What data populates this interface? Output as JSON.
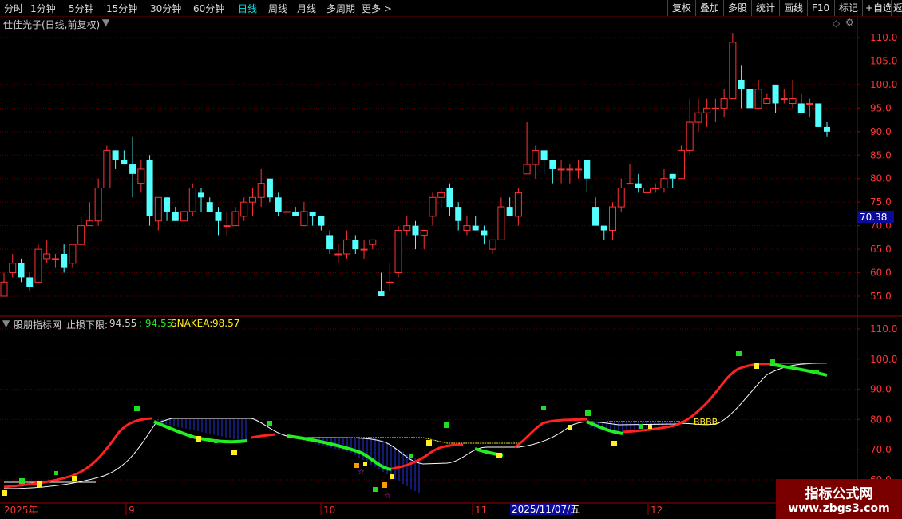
{
  "toolbar": {
    "periods": [
      "分时",
      "1分钟",
      "5分钟",
      "15分钟",
      "30分钟",
      "60分钟",
      "日线",
      "周线",
      "月线",
      "多周期",
      "更多 >"
    ],
    "active_period": "日线",
    "right_buttons": [
      "复权",
      "叠加",
      "多股",
      "统计",
      "画线",
      "F10",
      "标记",
      "+自选",
      "返回"
    ]
  },
  "kline": {
    "title": "仕佳光子(日线,前复权)",
    "price_axis": [
      "110.0",
      "105.0",
      "100.0",
      "95.0",
      "90.0",
      "85.0",
      "80.0",
      "75.0",
      "70.0",
      "65.0",
      "60.0",
      "55.0"
    ],
    "current_price_label": "70.38",
    "up_color": "#ff3333",
    "down_color": "#54ffff"
  },
  "indicator": {
    "name": "股朋指标网",
    "label_stop": "止损下限:",
    "value_stop": "94.55",
    "sep_value": ": 94.55",
    "label_snake": "SNAKEA:",
    "value_snake": "98.57",
    "axis": [
      "110.0",
      "100.0",
      "90.0",
      "80.0",
      "70.0",
      "60.0"
    ],
    "annotation": "BBBB"
  },
  "time_axis": {
    "labels": [
      "2025年",
      "9",
      "10",
      "11",
      "2025/11/07/五",
      "12"
    ]
  },
  "watermark": {
    "line1": "指标公式网",
    "line2": "www.zbgs3.com"
  },
  "chart_data": {
    "type": "candlestick",
    "ohlc": [
      [
        55,
        60,
        57,
        58
      ],
      [
        60,
        64,
        59,
        62
      ],
      [
        62,
        63,
        58,
        59
      ],
      [
        59,
        60,
        56,
        57
      ],
      [
        58,
        66,
        58,
        65
      ],
      [
        63,
        67,
        62,
        64
      ],
      [
        63,
        64,
        61,
        63
      ],
      [
        64,
        66,
        60,
        61
      ],
      [
        62,
        66,
        61,
        66
      ],
      [
        66,
        72,
        66,
        70
      ],
      [
        70,
        75,
        70,
        71
      ],
      [
        71,
        80,
        70,
        78
      ],
      [
        78,
        87,
        78,
        86
      ],
      [
        86,
        86,
        82,
        84
      ],
      [
        84,
        86,
        83,
        83
      ],
      [
        83,
        89,
        76,
        81
      ],
      [
        79,
        84,
        77,
        82
      ],
      [
        84,
        85,
        70,
        72
      ],
      [
        71,
        75,
        69,
        76
      ],
      [
        76,
        76,
        71,
        73
      ],
      [
        73,
        74,
        71,
        71
      ],
      [
        71,
        74,
        72,
        73
      ],
      [
        73,
        79,
        72,
        78
      ],
      [
        77,
        78,
        73,
        76
      ],
      [
        75,
        76,
        73,
        73
      ],
      [
        73,
        74,
        68,
        71
      ],
      [
        70,
        73,
        68,
        70
      ],
      [
        70,
        74,
        70,
        73
      ],
      [
        72,
        76,
        71,
        75
      ],
      [
        75,
        78,
        72,
        76
      ],
      [
        76,
        82,
        74,
        79
      ],
      [
        80,
        80,
        75,
        76
      ],
      [
        76,
        77,
        72,
        73
      ],
      [
        73,
        75,
        72,
        73
      ],
      [
        73,
        74,
        72,
        72
      ],
      [
        70,
        75,
        70,
        73
      ],
      [
        73,
        73,
        70,
        72
      ],
      [
        72,
        72,
        69,
        70
      ],
      [
        68,
        69,
        64,
        65
      ],
      [
        64,
        66,
        62,
        64
      ],
      [
        64,
        69,
        63,
        67
      ],
      [
        67,
        68,
        64,
        65
      ],
      [
        65,
        67,
        63,
        65
      ],
      [
        66,
        67,
        65,
        67
      ],
      [
        56,
        60,
        55,
        55
      ],
      [
        58,
        62,
        56,
        58
      ],
      [
        60,
        70,
        59,
        69
      ],
      [
        69,
        72,
        68,
        70
      ],
      [
        70,
        71,
        65,
        68
      ],
      [
        68,
        69,
        65,
        69
      ],
      [
        72,
        77,
        70,
        76
      ],
      [
        76,
        78,
        74,
        77
      ],
      [
        78,
        79,
        72,
        74
      ],
      [
        74,
        75,
        69,
        71
      ],
      [
        69,
        72,
        68,
        70
      ],
      [
        70,
        72,
        69,
        69
      ],
      [
        69,
        70,
        66,
        68
      ],
      [
        65,
        67,
        64,
        67
      ],
      [
        67,
        76,
        67,
        74
      ],
      [
        74,
        76,
        72,
        72
      ],
      [
        72,
        78,
        70,
        77
      ],
      [
        81,
        92,
        81,
        83
      ],
      [
        83,
        87,
        80,
        86
      ],
      [
        86,
        86,
        81,
        84
      ],
      [
        84,
        84,
        79,
        82
      ],
      [
        82,
        84,
        79,
        82
      ],
      [
        82,
        83,
        79,
        82
      ],
      [
        82,
        84,
        80,
        82
      ],
      [
        84,
        84,
        77,
        80
      ],
      [
        74,
        76,
        70,
        70
      ],
      [
        70,
        70,
        67,
        69
      ],
      [
        69,
        75,
        67,
        74
      ],
      [
        74,
        80,
        73,
        78
      ],
      [
        79,
        83,
        79,
        79
      ],
      [
        79,
        81,
        77,
        78
      ],
      [
        77,
        79,
        76,
        78
      ],
      [
        78,
        79,
        77,
        78
      ],
      [
        78,
        82,
        77,
        80
      ],
      [
        81,
        81,
        78,
        80
      ],
      [
        80,
        87,
        80,
        86
      ],
      [
        86,
        97,
        85,
        92
      ],
      [
        92,
        97,
        90,
        94
      ],
      [
        94,
        97,
        91,
        95
      ],
      [
        95,
        97,
        92,
        95
      ],
      [
        95,
        99,
        93,
        97
      ],
      [
        97,
        111,
        97,
        109
      ],
      [
        101,
        104,
        95,
        99
      ],
      [
        99,
        98,
        95,
        95
      ],
      [
        95,
        101,
        95,
        99
      ],
      [
        96,
        98,
        97,
        97
      ],
      [
        100,
        100,
        94,
        96
      ],
      [
        97,
        99,
        96,
        97
      ],
      [
        96,
        101,
        95,
        97
      ],
      [
        96,
        98,
        94,
        94
      ],
      [
        96,
        97,
        93,
        96
      ],
      [
        96,
        96,
        91,
        91
      ],
      [
        91,
        92,
        89,
        90
      ]
    ]
  }
}
